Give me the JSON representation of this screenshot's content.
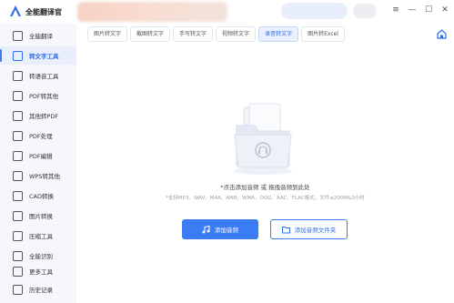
{
  "app": {
    "title": "全能翻译官"
  },
  "window": {
    "minimize": "—",
    "maximize": "☐",
    "close": "✕"
  },
  "sidebar": {
    "items": [
      {
        "label": "全能翻译",
        "icon": "translate-icon",
        "active": false
      },
      {
        "label": "转文字工具",
        "icon": "text-tool-icon",
        "active": true
      },
      {
        "label": "转语音工具",
        "icon": "voice-tool-icon",
        "active": false
      },
      {
        "label": "PDF转其他",
        "icon": "pdf-convert-icon",
        "active": false
      },
      {
        "label": "其他转PDF",
        "icon": "to-pdf-icon",
        "active": false
      },
      {
        "label": "PDF处理",
        "icon": "pdf-process-icon",
        "active": false
      },
      {
        "label": "PDF编辑",
        "icon": "pdf-edit-icon",
        "active": false
      },
      {
        "label": "WPS转其他",
        "icon": "wps-convert-icon",
        "active": false
      },
      {
        "label": "CAD转换",
        "icon": "cad-icon",
        "active": false
      },
      {
        "label": "图片转换",
        "icon": "image-convert-icon",
        "active": false
      },
      {
        "label": "压缩工具",
        "icon": "compress-icon",
        "active": false
      },
      {
        "label": "全能识别",
        "icon": "recognize-icon",
        "active": false
      },
      {
        "label": "更多工具",
        "icon": "more-tools-icon",
        "active": false
      },
      {
        "label": "历史记录",
        "icon": "history-icon",
        "active": false
      }
    ]
  },
  "tabs": [
    {
      "label": "图片转文字",
      "active": false
    },
    {
      "label": "截图转文字",
      "active": false
    },
    {
      "label": "手写转文字",
      "active": false
    },
    {
      "label": "视频转文字",
      "active": false
    },
    {
      "label": "录音转文字",
      "active": true
    },
    {
      "label": "图片转Excel",
      "active": false
    }
  ],
  "upload": {
    "hint": "*点击添加音频 或 拖拽音频到此处",
    "formats": "*支持MP3、WAV、M4A、AMR、WMA、OGG、AAC、FLAC格式，文件≤200M&3小时",
    "add_button": "添加音频",
    "add_folder_button": "添加音频文件夹"
  },
  "colors": {
    "accent": "#3b7cf5",
    "sidebar_bg": "#f6f7fa",
    "active_bg": "#e8eefb"
  }
}
